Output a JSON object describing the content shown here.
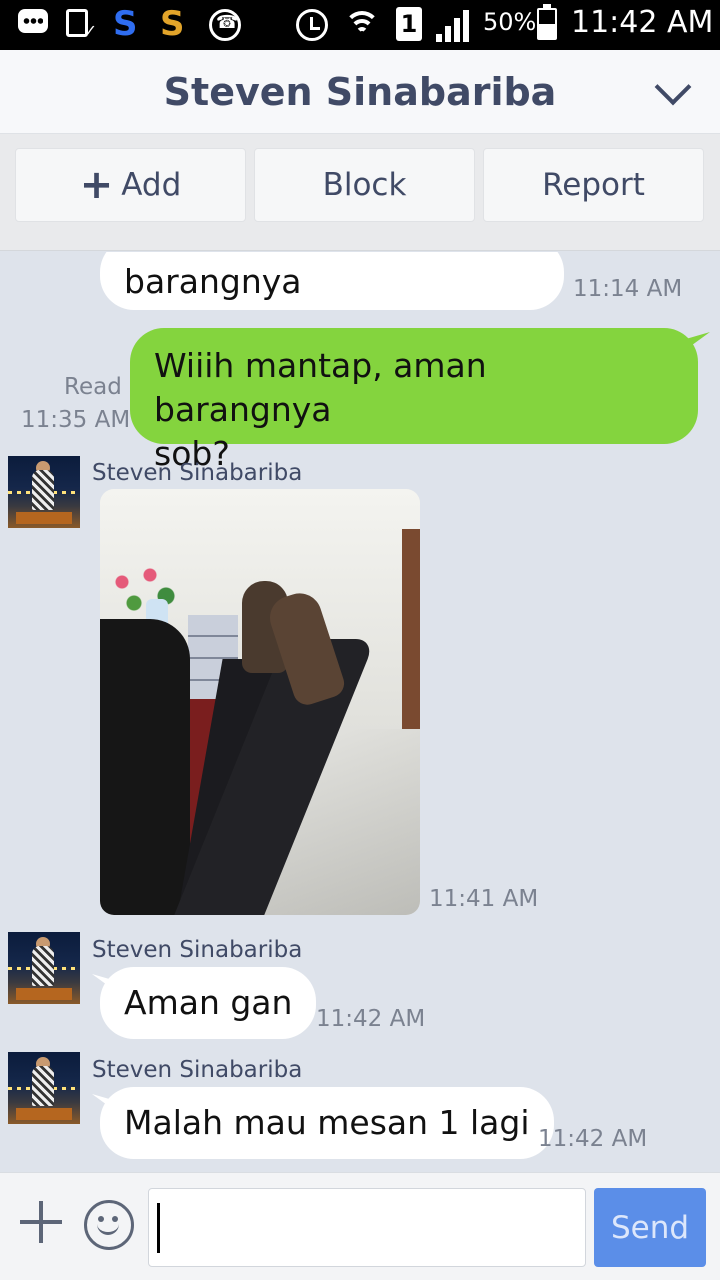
{
  "status_bar": {
    "battery": "50%",
    "time": "11:42 AM",
    "sim_slot": "1"
  },
  "header": {
    "title": "Steven Sinabariba"
  },
  "actions": {
    "add_label": "Add",
    "block_label": "Block",
    "report_label": "Report"
  },
  "messages": [
    {
      "direction": "in",
      "type": "text",
      "text": "barangnya",
      "time": "11:14 AM"
    },
    {
      "direction": "out",
      "type": "text",
      "lines": [
        "Wiiih mantap, aman barangnya",
        "sob?"
      ],
      "read": "Read",
      "time": "11:35 AM"
    },
    {
      "direction": "in",
      "type": "image",
      "sender": "Steven Sinabariba",
      "time": "11:41 AM"
    },
    {
      "direction": "in",
      "type": "text",
      "sender": "Steven Sinabariba",
      "text": "Aman gan",
      "time": "11:42 AM"
    },
    {
      "direction": "in",
      "type": "text",
      "sender": "Steven Sinabariba",
      "text": "Malah mau mesan 1 lagi",
      "time": "11:42 AM"
    }
  ],
  "input": {
    "value": "",
    "send_label": "Send"
  },
  "colors": {
    "outgoing_bubble": "#84d43e",
    "send_button": "#5b8ee8",
    "header_text": "#404a66",
    "chat_background": "#dee3eb"
  }
}
